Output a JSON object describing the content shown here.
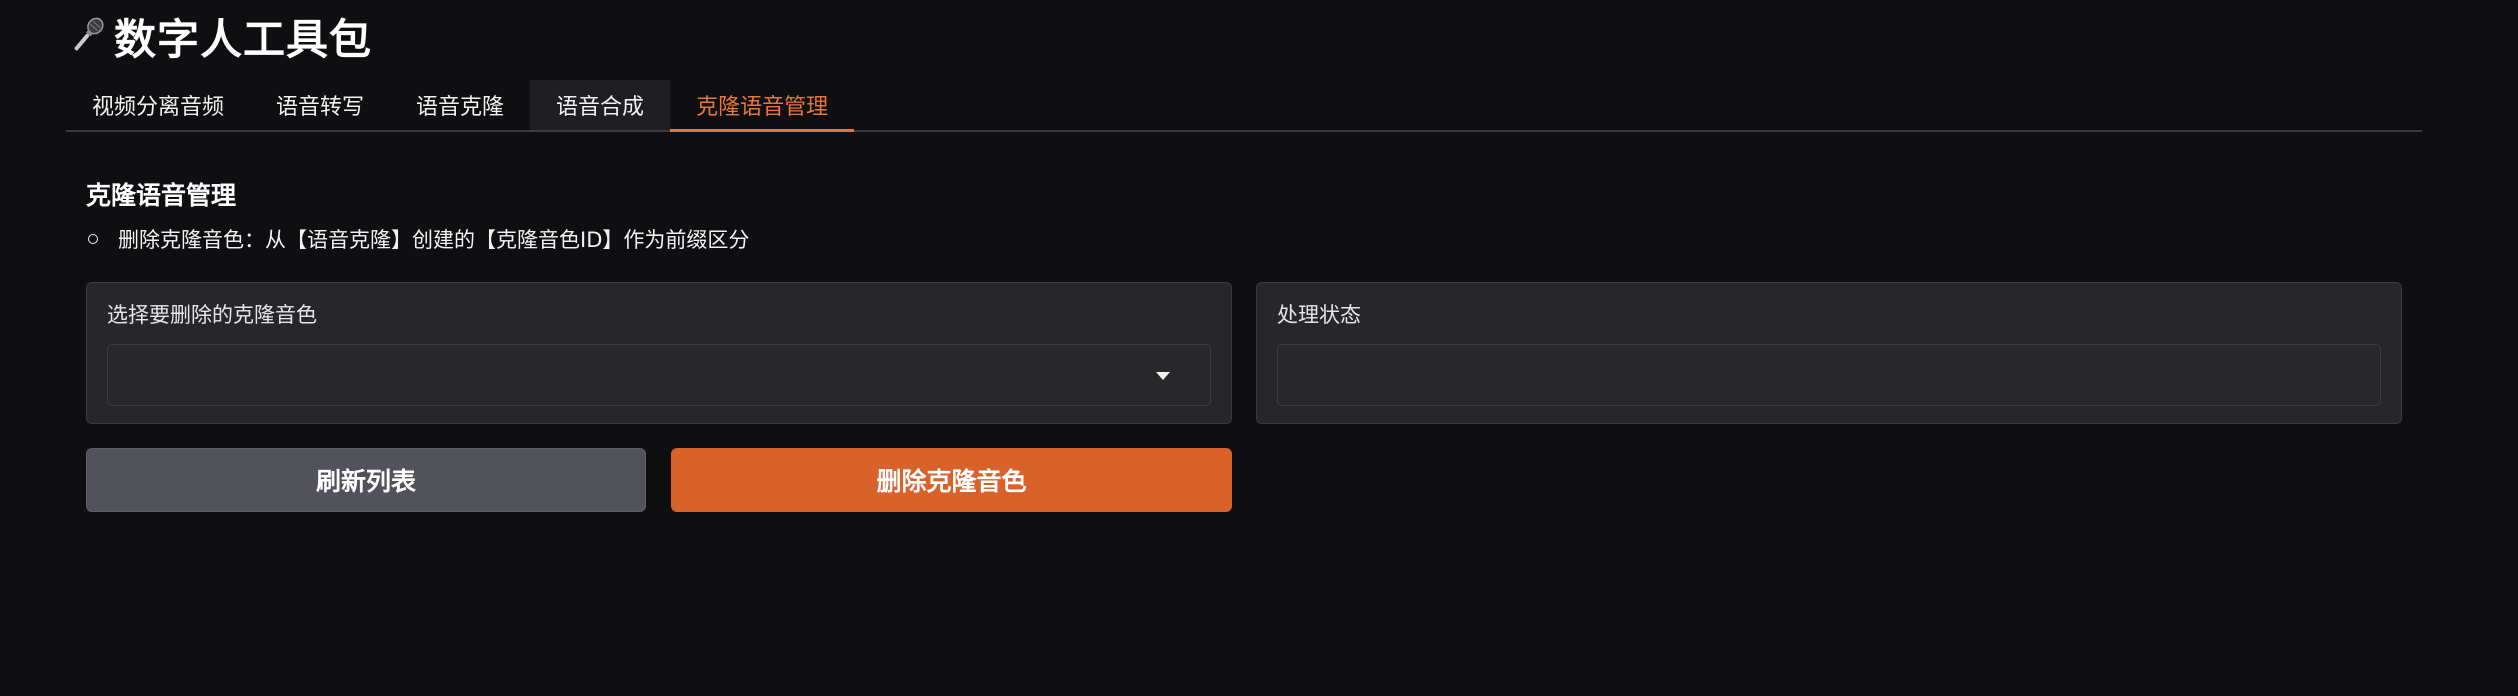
{
  "app": {
    "title": "数字人工具包",
    "title_icon": "microphone-icon"
  },
  "tabs": [
    {
      "label": "视频分离音频",
      "state": "default"
    },
    {
      "label": "语音转写",
      "state": "default"
    },
    {
      "label": "语音克隆",
      "state": "default"
    },
    {
      "label": "语音合成",
      "state": "hover"
    },
    {
      "label": "克隆语音管理",
      "state": "active"
    }
  ],
  "section": {
    "heading": "克隆语音管理",
    "bullet": "删除克隆音色：从【语音克隆】创建的【克隆音色ID】作为前缀区分"
  },
  "voice_select": {
    "label": "选择要删除的克隆音色",
    "value": ""
  },
  "status": {
    "label": "处理状态",
    "value": ""
  },
  "buttons": {
    "refresh_label": "刷新列表",
    "delete_label": "删除克隆音色"
  },
  "colors": {
    "background": "#0f0f11",
    "accent": "#e8763a",
    "delete_button": "#d9622b",
    "secondary_button": "#52525b",
    "panel": "#27272a"
  }
}
